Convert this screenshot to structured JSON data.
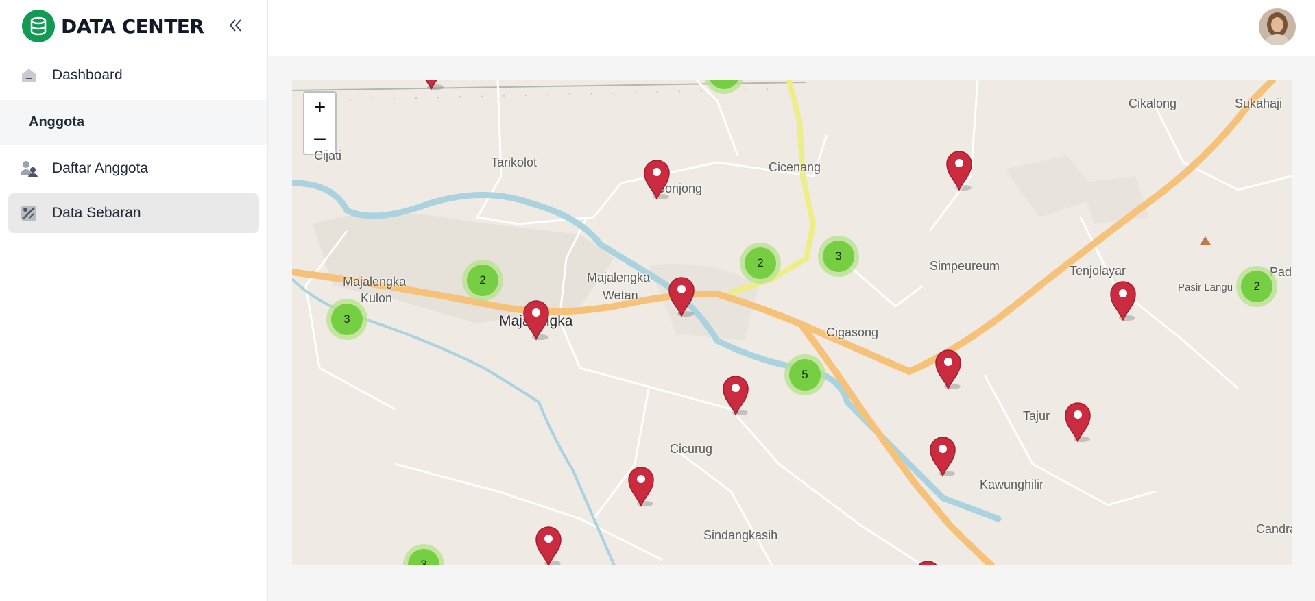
{
  "app": {
    "title": "DATA CENTER"
  },
  "sidebar": {
    "items": [
      {
        "label": "Dashboard",
        "icon": "home-icon"
      },
      {
        "label": "Daftar Anggota",
        "icon": "users-icon"
      },
      {
        "label": "Data Sebaran",
        "icon": "map-icon"
      }
    ],
    "section": "Anggota",
    "active": "Data Sebaran"
  },
  "map": {
    "zoom_in": "+",
    "zoom_out": "–",
    "places": [
      "Cijati",
      "Tarikolot",
      "Sonjong",
      "Cicenang",
      "Cikalong",
      "Sukahaji",
      "Majalengka",
      "Kulon",
      "Majalengka",
      "Wetan",
      "Majalengka",
      "Simpeureum",
      "Tenjolayar",
      "Pasir Langu",
      "Pad",
      "Cigasong",
      "Tajur",
      "Cicurug",
      "Kawunghilir",
      "Sindangkasih",
      "Candraj"
    ],
    "clusters": [
      "2",
      "3",
      "2",
      "3",
      "5",
      "2",
      "3"
    ],
    "colors": {
      "pin": "#cb2b3e",
      "cluster_inner": "#6ecc39",
      "cluster_outer": "#b5e28c",
      "road_major": "#f6c27a",
      "road_trunk": "#eeee88",
      "river": "#aad3df"
    }
  },
  "user": {
    "avatar": "user-avatar"
  }
}
